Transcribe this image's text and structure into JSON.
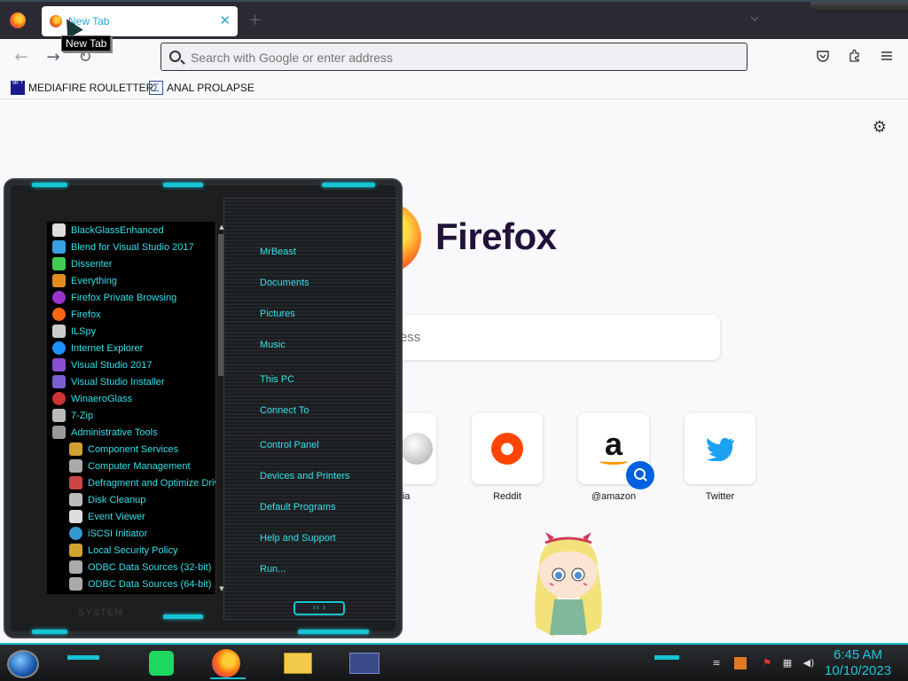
{
  "browser": {
    "tab": {
      "title": "New Tab"
    },
    "tooltip": "New Tab",
    "urlbar": {
      "placeholder": "Search with Google or enter address"
    },
    "bookmarks": [
      {
        "label": "MEDIAFIRE ROULETTER",
        "icon": "mediafire-icon",
        "icon_text": "MF T"
      },
      {
        "label": "ANAL PROLAPSE",
        "icon": "sigma-icon",
        "icon_text": "Σ"
      }
    ]
  },
  "newtab": {
    "brand": "Firefox",
    "search_placeholder": "Search with Google or enter address",
    "tiles": [
      {
        "label": "Wikipedia",
        "visible_label": "edia",
        "icon": "wikipedia-icon"
      },
      {
        "label": "Reddit",
        "icon": "reddit-icon"
      },
      {
        "label": "@amazon",
        "icon": "amazon-icon"
      },
      {
        "label": "Twitter",
        "icon": "twitter-icon"
      }
    ]
  },
  "start_menu": {
    "programs": [
      {
        "label": "BlackGlassEnhanced",
        "color": "#dddddd"
      },
      {
        "label": "Blend for Visual Studio 2017",
        "color": "#3aa0e0"
      },
      {
        "label": "Dissenter",
        "color": "#44cc55"
      },
      {
        "label": "Everything",
        "color": "#e08a20"
      },
      {
        "label": "Firefox Private Browsing",
        "color": "#9933cc"
      },
      {
        "label": "Firefox",
        "color": "#ff6611"
      },
      {
        "label": "ILSpy",
        "color": "#cccccc"
      },
      {
        "label": "Internet Explorer",
        "color": "#1e90ff"
      },
      {
        "label": "Visual Studio 2017",
        "color": "#8a4fd0"
      },
      {
        "label": "Visual Studio Installer",
        "color": "#7a5fd0"
      },
      {
        "label": "WinaeroGlass",
        "color": "#cc3333"
      },
      {
        "label": "7-Zip",
        "color": "#bbbbbb"
      },
      {
        "label": "Administrative Tools",
        "color": "#999999"
      }
    ],
    "admin_tools": [
      {
        "label": "Component Services",
        "color": "#d0a030"
      },
      {
        "label": "Computer Management",
        "color": "#aaaaaa"
      },
      {
        "label": "Defragment and Optimize Drives",
        "color": "#cc4444"
      },
      {
        "label": "Disk Cleanup",
        "color": "#bbbbbb"
      },
      {
        "label": "Event Viewer",
        "color": "#dddddd"
      },
      {
        "label": "iSCSI Initiator",
        "color": "#3399cc"
      },
      {
        "label": "Local Security Policy",
        "color": "#d0a030"
      },
      {
        "label": "ODBC Data Sources (32-bit)",
        "color": "#aaaaaa"
      },
      {
        "label": "ODBC Data Sources (64-bit)",
        "color": "#aaaaaa"
      }
    ],
    "right_items": [
      "MrBeast",
      "Documents",
      "Pictures",
      "Music",
      "This PC",
      "Connect To",
      "Control Panel",
      "Devices and Printers",
      "Default Programs",
      "Help and Support",
      "Run..."
    ],
    "footer": "SYSTEM"
  },
  "taskbar": {
    "apps": [
      "spotify-icon",
      "firefox-icon",
      "file-explorer-icon",
      "window-app-icon"
    ],
    "time": "6:45 AM",
    "date": "10/10/2023"
  },
  "colors": {
    "accent": "#16c4d4",
    "menu_text": "#35e0e8"
  }
}
